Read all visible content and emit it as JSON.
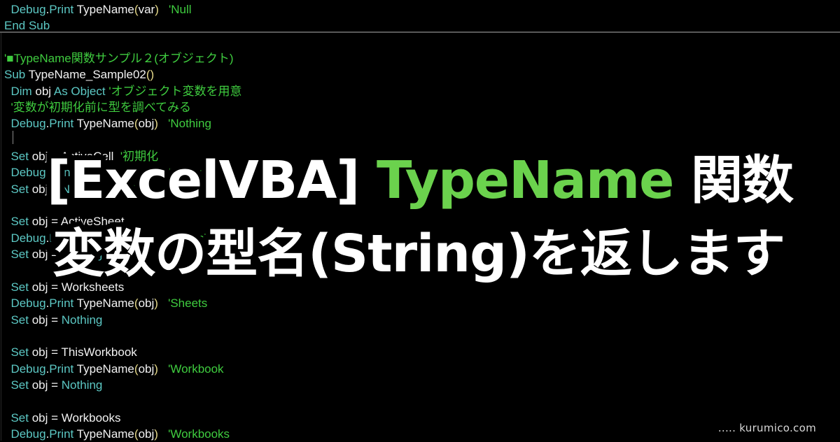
{
  "code_lines": [
    [
      {
        "t": "  ",
        "c": "tx"
      },
      {
        "t": "Debug",
        "c": "kw"
      },
      {
        "t": ".",
        "c": "tx"
      },
      {
        "t": "Print",
        "c": "kw"
      },
      {
        "t": " TypeName",
        "c": "tx"
      },
      {
        "t": "(",
        "c": "pn"
      },
      {
        "t": "var",
        "c": "tx"
      },
      {
        "t": ")",
        "c": "pn"
      },
      {
        "t": "   ",
        "c": "tx"
      },
      {
        "t": "'Null",
        "c": "cm"
      }
    ],
    [
      {
        "t": "End Sub",
        "c": "kw"
      }
    ],
    [],
    [
      {
        "t": "'■TypeName関数サンプル２(オブジェクト)",
        "c": "cm"
      }
    ],
    [
      {
        "t": "Sub",
        "c": "kw"
      },
      {
        "t": " TypeName_Sample02",
        "c": "tx"
      },
      {
        "t": "()",
        "c": "pn"
      }
    ],
    [
      {
        "t": "  ",
        "c": "tx"
      },
      {
        "t": "Dim",
        "c": "kw"
      },
      {
        "t": " obj ",
        "c": "tx"
      },
      {
        "t": "As Object",
        "c": "kw"
      },
      {
        "t": " ",
        "c": "tx"
      },
      {
        "t": "'オブジェクト変数を用意",
        "c": "cm"
      }
    ],
    [
      {
        "t": "  ",
        "c": "tx"
      },
      {
        "t": "'変数が初期化前に型を調べてみる",
        "c": "cm"
      }
    ],
    [
      {
        "t": "  ",
        "c": "tx"
      },
      {
        "t": "Debug",
        "c": "kw"
      },
      {
        "t": ".",
        "c": "tx"
      },
      {
        "t": "Print",
        "c": "kw"
      },
      {
        "t": " TypeName",
        "c": "tx"
      },
      {
        "t": "(",
        "c": "pn"
      },
      {
        "t": "obj",
        "c": "tx"
      },
      {
        "t": ")",
        "c": "pn"
      },
      {
        "t": "   ",
        "c": "tx"
      },
      {
        "t": "'Nothing",
        "c": "cm"
      }
    ],
    [],
    [
      {
        "t": "  ",
        "c": "tx"
      },
      {
        "t": "Set",
        "c": "kw"
      },
      {
        "t": " obj = ActiveCell  ",
        "c": "tx"
      },
      {
        "t": "'初期化",
        "c": "cm"
      }
    ],
    [
      {
        "t": "  ",
        "c": "tx"
      },
      {
        "t": "Debug",
        "c": "kw"
      },
      {
        "t": ".",
        "c": "tx"
      },
      {
        "t": "Print",
        "c": "kw"
      },
      {
        "t": " TypeName",
        "c": "tx"
      },
      {
        "t": "(",
        "c": "pn"
      },
      {
        "t": "obj",
        "c": "tx"
      },
      {
        "t": ")",
        "c": "pn"
      },
      {
        "t": "   ",
        "c": "tx"
      },
      {
        "t": "'Range",
        "c": "cm"
      }
    ],
    [
      {
        "t": "  ",
        "c": "tx"
      },
      {
        "t": "Set",
        "c": "kw"
      },
      {
        "t": " obj = ",
        "c": "tx"
      },
      {
        "t": "Nothing",
        "c": "kw"
      },
      {
        "t": "  ",
        "c": "tx"
      },
      {
        "t": "'解放",
        "c": "cm"
      }
    ],
    [],
    [
      {
        "t": "  ",
        "c": "tx"
      },
      {
        "t": "Set",
        "c": "kw"
      },
      {
        "t": " obj = ActiveSheet",
        "c": "tx"
      }
    ],
    [
      {
        "t": "  ",
        "c": "tx"
      },
      {
        "t": "Debug",
        "c": "kw"
      },
      {
        "t": ".",
        "c": "tx"
      },
      {
        "t": "Print",
        "c": "kw"
      },
      {
        "t": " TypeName",
        "c": "tx"
      },
      {
        "t": "(",
        "c": "pn"
      },
      {
        "t": "obj",
        "c": "tx"
      },
      {
        "t": ")",
        "c": "pn"
      },
      {
        "t": "   ",
        "c": "tx"
      },
      {
        "t": "'Worksheet",
        "c": "cm"
      }
    ],
    [
      {
        "t": "  ",
        "c": "tx"
      },
      {
        "t": "Set",
        "c": "kw"
      },
      {
        "t": " obj = ",
        "c": "tx"
      },
      {
        "t": "Nothing",
        "c": "kw"
      }
    ],
    [],
    [
      {
        "t": "  ",
        "c": "tx"
      },
      {
        "t": "Set",
        "c": "kw"
      },
      {
        "t": " obj = Worksheets",
        "c": "tx"
      }
    ],
    [
      {
        "t": "  ",
        "c": "tx"
      },
      {
        "t": "Debug",
        "c": "kw"
      },
      {
        "t": ".",
        "c": "tx"
      },
      {
        "t": "Print",
        "c": "kw"
      },
      {
        "t": " TypeName",
        "c": "tx"
      },
      {
        "t": "(",
        "c": "pn"
      },
      {
        "t": "obj",
        "c": "tx"
      },
      {
        "t": ")",
        "c": "pn"
      },
      {
        "t": "   ",
        "c": "tx"
      },
      {
        "t": "'Sheets",
        "c": "cm"
      }
    ],
    [
      {
        "t": "  ",
        "c": "tx"
      },
      {
        "t": "Set",
        "c": "kw"
      },
      {
        "t": " obj = ",
        "c": "tx"
      },
      {
        "t": "Nothing",
        "c": "kw"
      }
    ],
    [],
    [
      {
        "t": "  ",
        "c": "tx"
      },
      {
        "t": "Set",
        "c": "kw"
      },
      {
        "t": " obj = ThisWorkbook",
        "c": "tx"
      }
    ],
    [
      {
        "t": "  ",
        "c": "tx"
      },
      {
        "t": "Debug",
        "c": "kw"
      },
      {
        "t": ".",
        "c": "tx"
      },
      {
        "t": "Print",
        "c": "kw"
      },
      {
        "t": " TypeName",
        "c": "tx"
      },
      {
        "t": "(",
        "c": "pn"
      },
      {
        "t": "obj",
        "c": "tx"
      },
      {
        "t": ")",
        "c": "pn"
      },
      {
        "t": "   ",
        "c": "tx"
      },
      {
        "t": "'Workbook",
        "c": "cm"
      }
    ],
    [
      {
        "t": "  ",
        "c": "tx"
      },
      {
        "t": "Set",
        "c": "kw"
      },
      {
        "t": " obj = ",
        "c": "tx"
      },
      {
        "t": "Nothing",
        "c": "kw"
      }
    ],
    [],
    [
      {
        "t": "  ",
        "c": "tx"
      },
      {
        "t": "Set",
        "c": "kw"
      },
      {
        "t": " obj = Workbooks",
        "c": "tx"
      }
    ],
    [
      {
        "t": "  ",
        "c": "tx"
      },
      {
        "t": "Debug",
        "c": "kw"
      },
      {
        "t": ".",
        "c": "tx"
      },
      {
        "t": "Print",
        "c": "kw"
      },
      {
        "t": " TypeName",
        "c": "tx"
      },
      {
        "t": "(",
        "c": "pn"
      },
      {
        "t": "obj",
        "c": "tx"
      },
      {
        "t": ")",
        "c": "pn"
      },
      {
        "t": "   ",
        "c": "tx"
      },
      {
        "t": "'Workbooks",
        "c": "cm"
      }
    ]
  ],
  "title": {
    "line1_prefix": "[ExcelVBA] ",
    "line1_accent": "TypeName",
    "line1_suffix": " 関数",
    "line2": "変数の型名(String)を返します"
  },
  "watermark": "..... kurumico.com",
  "colors": {
    "background": "#000000",
    "keyword": "#5cc8c4",
    "comment": "#3fcc3f",
    "paren": "#e6d98a",
    "text": "#f2f2f2",
    "title_accent": "#6bd24d",
    "title_text": "#ffffff"
  }
}
